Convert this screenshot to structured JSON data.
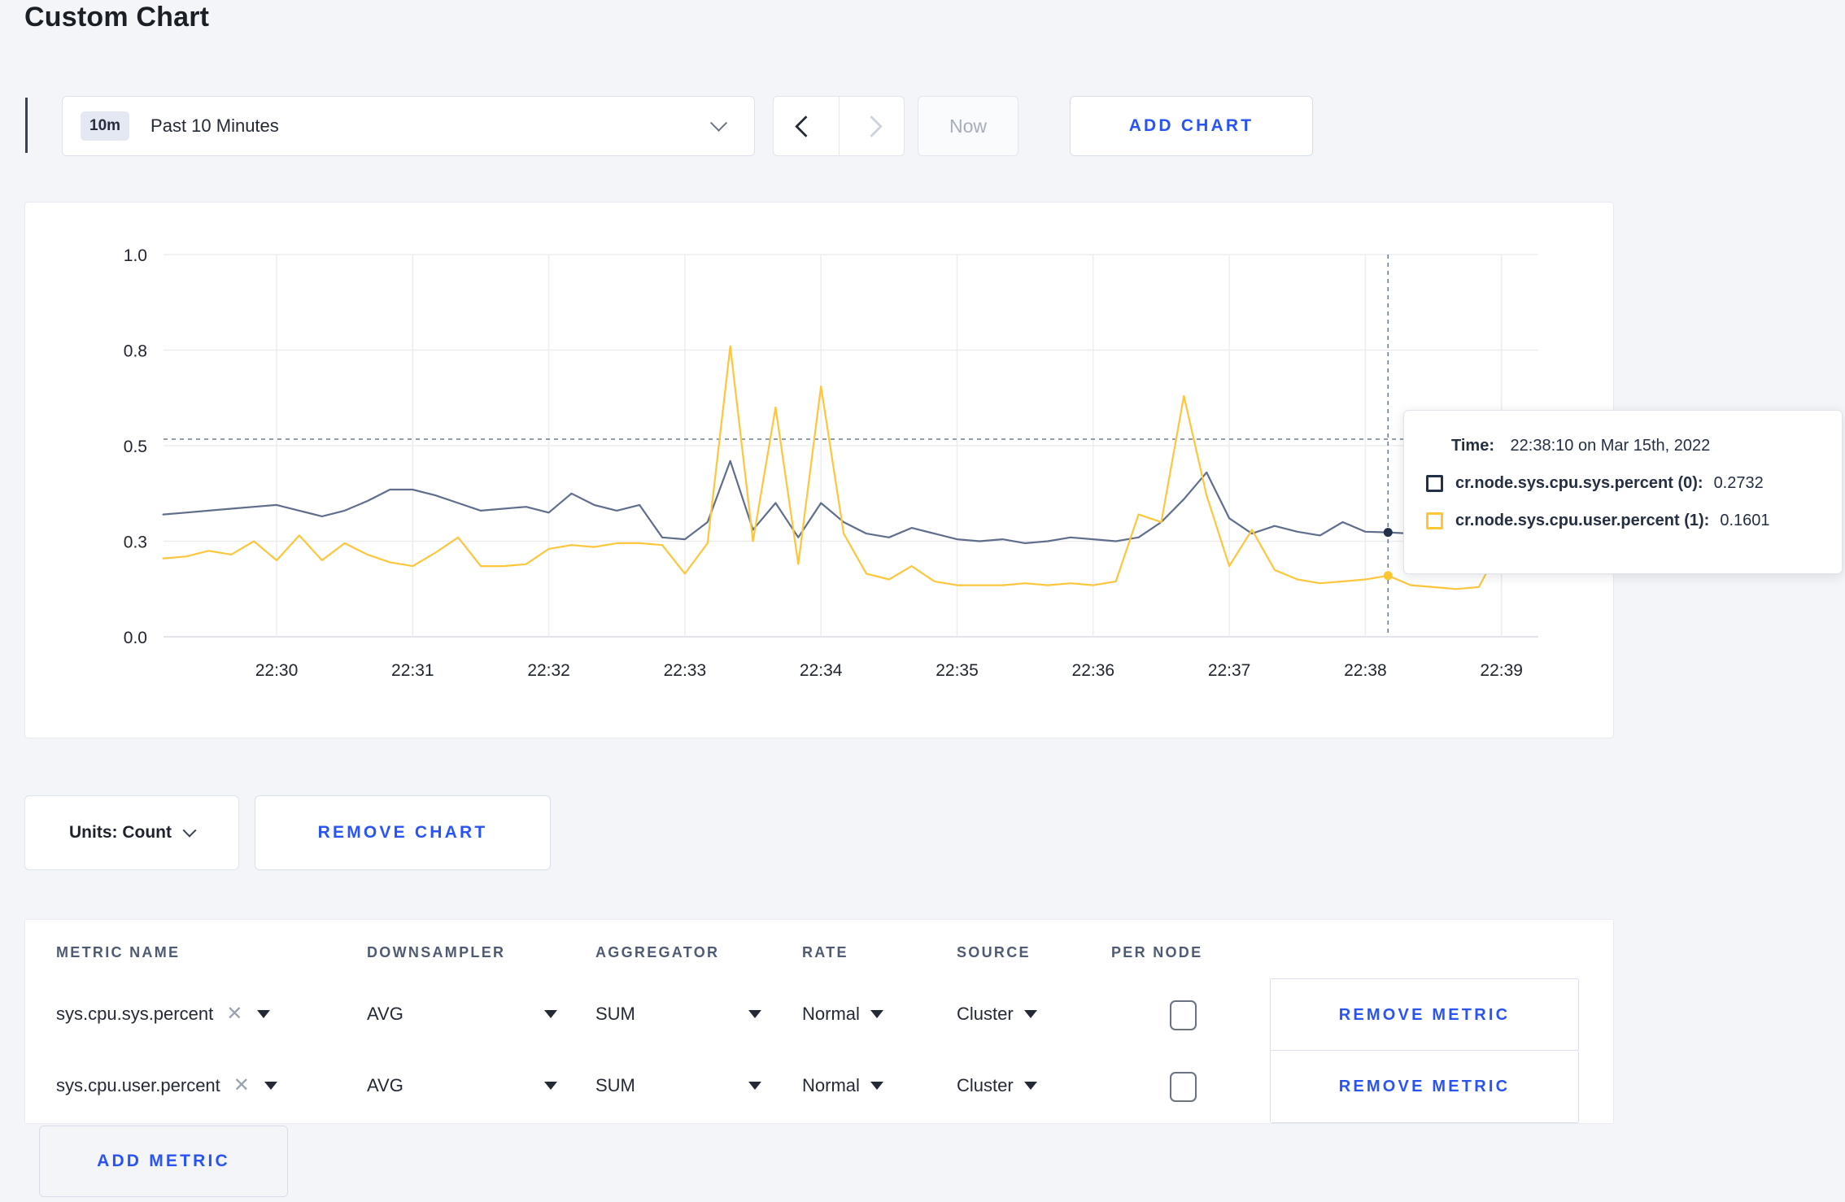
{
  "page": {
    "title": "Custom Chart"
  },
  "colors": {
    "accent_blue": "#2954f5",
    "page_bg": "#f4f5f9",
    "series_sys": "#5f6e8c",
    "series_user": "#fcc63d",
    "swatch_sys": "#22304a",
    "swatch_user": "#fdc731",
    "crosshair": "#5d7186",
    "gridline": "#ededf0"
  },
  "icons": {
    "time_select": "chevron-down-icon",
    "prev": "chevron-left-icon",
    "next": "chevron-right-icon",
    "units": "chevron-down-icon",
    "remove_tag_glyph": "✕"
  },
  "toolbar": {
    "time_badge": "10m",
    "time_label": "Past 10 Minutes",
    "now_label": "Now",
    "add_chart_label": "ADD CHART"
  },
  "chart_data": {
    "type": "line",
    "title": "",
    "x_start_time": "22:29:10",
    "sample_interval_sec": 10,
    "x_tick_labels": [
      "22:30",
      "22:31",
      "22:32",
      "22:33",
      "22:34",
      "22:35",
      "22:36",
      "22:37",
      "22:38",
      "22:39"
    ],
    "y_tick_labels": [
      "0.0",
      "0.3",
      "0.5",
      "0.8",
      "1.0"
    ],
    "y_tick_values": [
      0,
      0.25,
      0.5,
      0.75,
      1.0
    ],
    "ylim": [
      0,
      1
    ],
    "grid": true,
    "legend_position": "tooltip",
    "series": [
      {
        "name": "cr.node.sys.cpu.sys.percent",
        "color": "#5f6e8c",
        "dot_color": "#22304a",
        "values": [
          0.32,
          0.325,
          0.33,
          0.335,
          0.34,
          0.345,
          0.33,
          0.315,
          0.33,
          0.355,
          0.385,
          0.385,
          0.37,
          0.35,
          0.33,
          0.335,
          0.34,
          0.325,
          0.375,
          0.345,
          0.33,
          0.345,
          0.26,
          0.255,
          0.3,
          0.46,
          0.28,
          0.35,
          0.26,
          0.35,
          0.3,
          0.27,
          0.26,
          0.285,
          0.27,
          0.255,
          0.25,
          0.255,
          0.245,
          0.25,
          0.26,
          0.255,
          0.25,
          0.26,
          0.3,
          0.36,
          0.43,
          0.31,
          0.27,
          0.29,
          0.275,
          0.265,
          0.3,
          0.275,
          0.2732,
          0.27,
          0.275,
          0.27,
          0.27,
          0.27,
          0.27
        ]
      },
      {
        "name": "cr.node.sys.cpu.user.percent",
        "color": "#fcc63d",
        "dot_color": "#fdc731",
        "values": [
          0.205,
          0.21,
          0.225,
          0.215,
          0.25,
          0.2,
          0.265,
          0.2,
          0.245,
          0.215,
          0.195,
          0.185,
          0.22,
          0.26,
          0.185,
          0.185,
          0.19,
          0.23,
          0.24,
          0.235,
          0.245,
          0.245,
          0.24,
          0.165,
          0.245,
          0.76,
          0.25,
          0.6,
          0.19,
          0.655,
          0.27,
          0.165,
          0.15,
          0.185,
          0.145,
          0.135,
          0.135,
          0.135,
          0.14,
          0.135,
          0.14,
          0.135,
          0.145,
          0.32,
          0.3,
          0.63,
          0.37,
          0.185,
          0.28,
          0.175,
          0.15,
          0.14,
          0.145,
          0.15,
          0.1601,
          0.135,
          0.13,
          0.125,
          0.13,
          0.24,
          0.21
        ]
      }
    ],
    "crosshair": {
      "index": 54,
      "time": "22:38:10",
      "hline_value": 0.517
    }
  },
  "tooltip": {
    "time_label": "Time:",
    "time_value": "22:38:10 on Mar 15th, 2022",
    "rows": [
      {
        "label": "cr.node.sys.cpu.sys.percent (0):",
        "value": "0.2732"
      },
      {
        "label": "cr.node.sys.cpu.user.percent (1):",
        "value": "0.1601"
      }
    ]
  },
  "chart_footer": {
    "units_label": "Units: Count",
    "remove_chart_label": "REMOVE CHART"
  },
  "metrics_table": {
    "headers": [
      "METRIC NAME",
      "DOWNSAMPLER",
      "AGGREGATOR",
      "RATE",
      "SOURCE",
      "PER NODE"
    ],
    "rows": [
      {
        "metric": "sys.cpu.sys.percent",
        "downsampler": "AVG",
        "aggregator": "SUM",
        "rate": "Normal",
        "source": "Cluster",
        "per_node_checked": false,
        "remove_label": "REMOVE METRIC"
      },
      {
        "metric": "sys.cpu.user.percent",
        "downsampler": "AVG",
        "aggregator": "SUM",
        "rate": "Normal",
        "source": "Cluster",
        "per_node_checked": false,
        "remove_label": "REMOVE METRIC"
      }
    ],
    "add_metric_label": "ADD METRIC"
  }
}
